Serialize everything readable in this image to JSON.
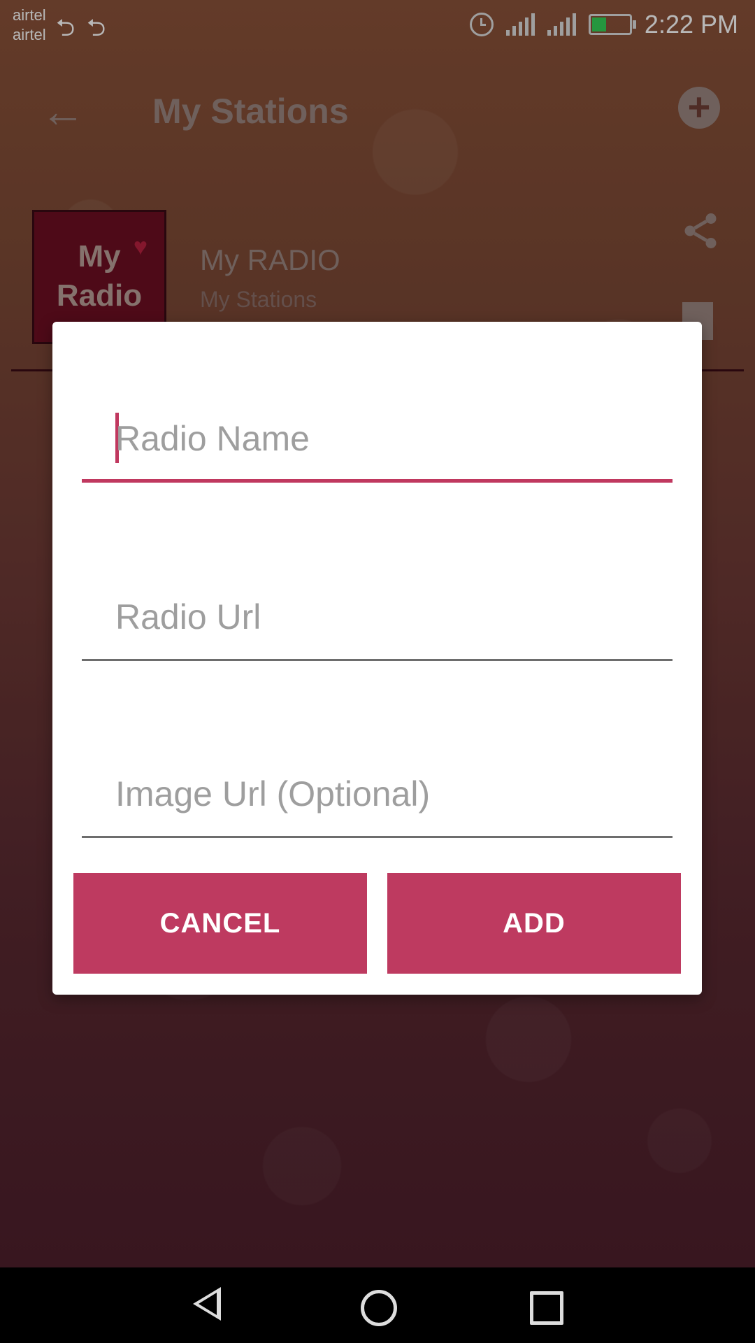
{
  "status_bar": {
    "carrier_1": "airtel",
    "carrier_2": "airtel",
    "time": "2:22 PM",
    "icons": [
      "usb-icon",
      "usb-icon",
      "alarm-icon",
      "signal-icon",
      "signal-icon",
      "battery-charging-icon"
    ]
  },
  "app_bar": {
    "title": "My Stations",
    "back_icon": "arrow-left-icon",
    "add_icon": "add-circle-icon"
  },
  "station": {
    "logo_line1": "My",
    "logo_line2": "Radio",
    "name": "My RADIO",
    "subtitle": "My Stations",
    "share_icon": "share-icon",
    "delete_icon": "trash-icon"
  },
  "dialog": {
    "radio_name_placeholder": "Radio Name",
    "radio_url_placeholder": "Radio Url",
    "image_url_placeholder": "Image Url (Optional)",
    "cancel_label": "CANCEL",
    "add_label": "ADD"
  },
  "colors": {
    "accent": "#be3a60",
    "focus_line": "#c0385f",
    "background_top": "#8a5239",
    "background_bottom": "#4e1f2c"
  }
}
